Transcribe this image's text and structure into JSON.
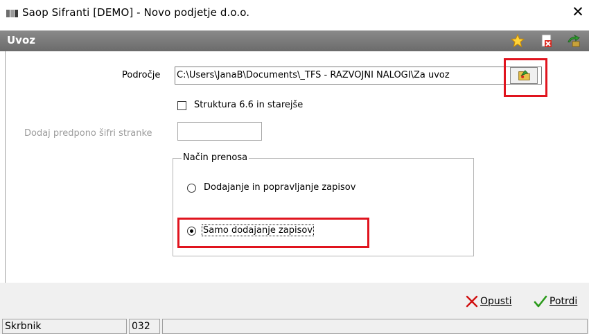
{
  "window": {
    "title": "Saop Sifranti [DEMO] - Novo podjetje d.o.o.",
    "close_symbol": "✕",
    "app_icon": "app-icon",
    "close_icon": "close-icon"
  },
  "header": {
    "title": "Uvoz",
    "icons": [
      "star-icon",
      "pdf-close-icon",
      "exit-icon"
    ]
  },
  "form": {
    "podrocje_label": "Področje",
    "podrocje_value": "C:\\Users\\JanaB\\Documents\\_TFS - RAZVOJNI NALOGI\\Za uvoz",
    "browse_icon": "folder-browse-icon",
    "struktura_label": "Struktura 6.6 in starejše",
    "struktura_checked": false,
    "dodaj_label": "Dodaj predpono šifri stranke",
    "dodaj_value": "",
    "nacin": {
      "legend": "Način prenosa",
      "options": [
        {
          "label": "Dodajanje in popravljanje zapisov",
          "selected": false
        },
        {
          "label": "Samo dodajanje zapisov",
          "selected": true
        }
      ]
    }
  },
  "footer": {
    "cancel_label": "Opusti",
    "confirm_label": "Potrdi",
    "cancel_icon": "x-icon",
    "confirm_icon": "checkmark-icon"
  },
  "statusbar": {
    "cells": [
      "Skrbnik",
      "032",
      ""
    ]
  },
  "colors": {
    "header_bar": "#7a7a7a",
    "highlight_red": "#e0141e",
    "cancel_red": "#d01010",
    "confirm_green": "#2a9a1a"
  }
}
